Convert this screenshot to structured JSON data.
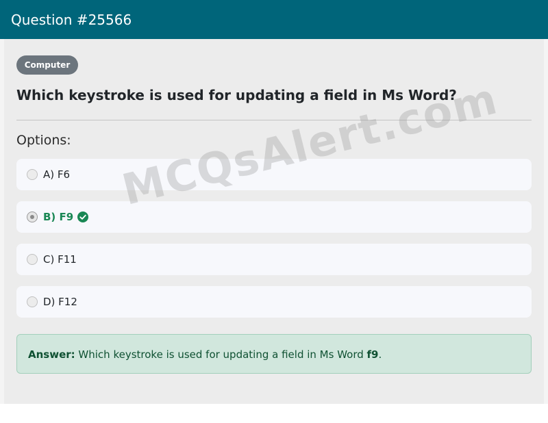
{
  "header": {
    "title": "Question #25566"
  },
  "badge": {
    "label": "Computer"
  },
  "question": {
    "text": "Which keystroke is used for updating a field in Ms Word?"
  },
  "options_heading": "Options:",
  "options": [
    {
      "label": "A) F6",
      "selected": false,
      "correct": false
    },
    {
      "label": "B) F9",
      "selected": true,
      "correct": true
    },
    {
      "label": "C) F11",
      "selected": false,
      "correct": false
    },
    {
      "label": "D) F12",
      "selected": false,
      "correct": false
    }
  ],
  "watermark": "MCQsAlert.com",
  "answer": {
    "label": "Answer:",
    "text": " Which keystroke is used for updating a field in Ms Word ",
    "value": "f9",
    "suffix": "."
  },
  "colors": {
    "header_bg": "#00657a",
    "correct": "#198754",
    "answer_bg": "#d1e7dd"
  },
  "icons": {
    "correct": "check-circle-icon"
  }
}
